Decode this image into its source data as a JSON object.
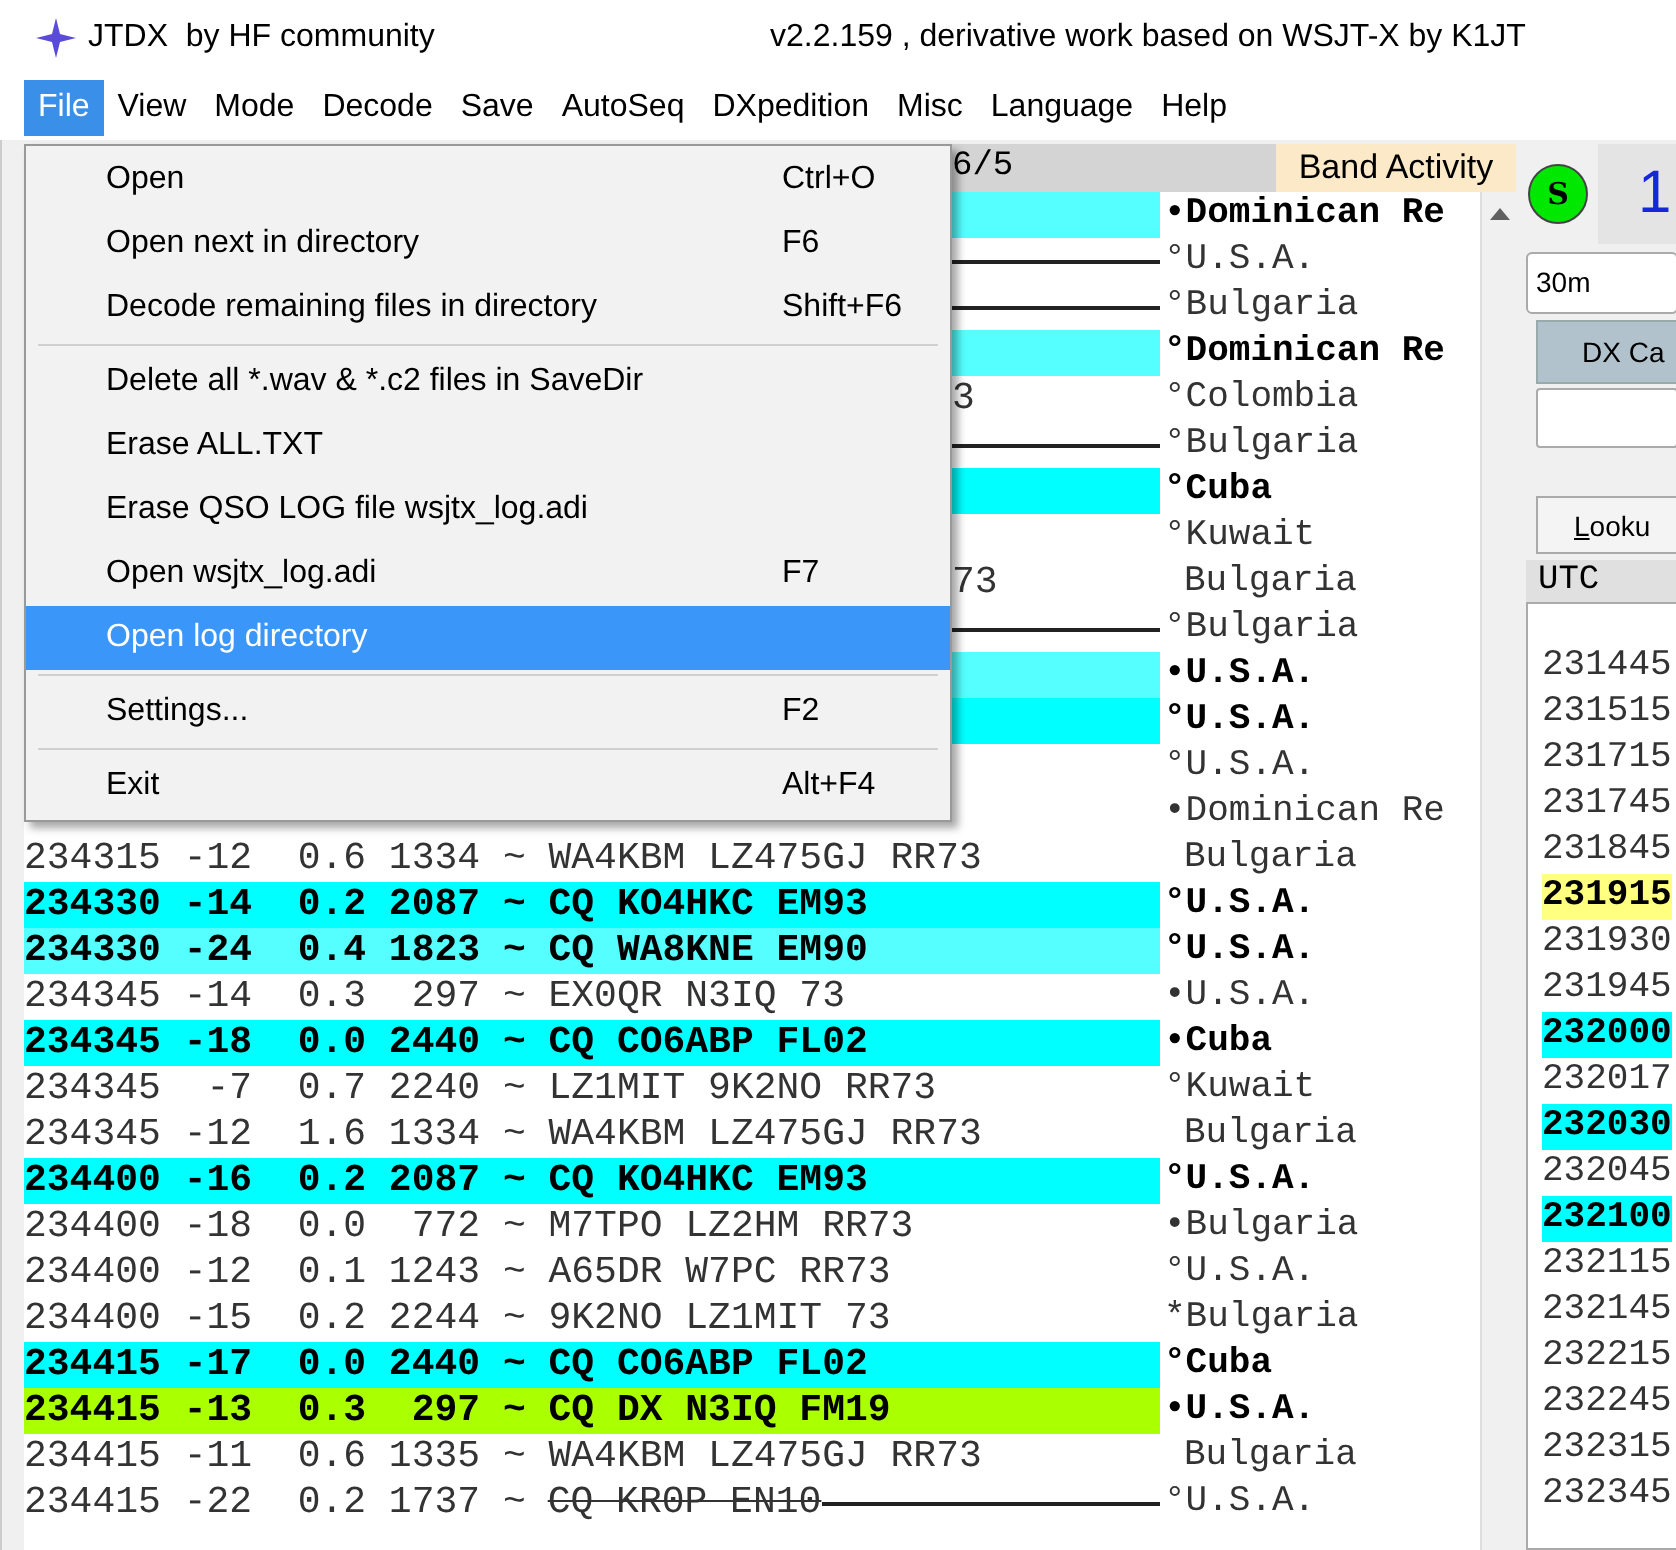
{
  "window": {
    "title": "JTDX  by HF community",
    "subtitle": "v2.2.159 , derivative work based on WSJT-X by K1JT"
  },
  "menu_bar": [
    {
      "label": "File",
      "selected": true
    },
    {
      "label": "View",
      "selected": false
    },
    {
      "label": "Mode",
      "selected": false
    },
    {
      "label": "Decode",
      "selected": false
    },
    {
      "label": "Save",
      "selected": false
    },
    {
      "label": "AutoSeq",
      "selected": false
    },
    {
      "label": "DXpedition",
      "selected": false
    },
    {
      "label": "Misc",
      "selected": false
    },
    {
      "label": "Language",
      "selected": false
    },
    {
      "label": "Help",
      "selected": false
    }
  ],
  "file_menu": [
    {
      "kind": "item",
      "label": "Open",
      "shortcut": "Ctrl+O",
      "selected": false
    },
    {
      "kind": "item",
      "label": "Open next in directory",
      "shortcut": "F6",
      "selected": false
    },
    {
      "kind": "item",
      "label": "Decode remaining files in directory",
      "shortcut": "Shift+F6",
      "selected": false
    },
    {
      "kind": "separator"
    },
    {
      "kind": "item",
      "label": "Delete all *.wav & *.c2 files in SaveDir",
      "selected": false
    },
    {
      "kind": "item",
      "label": "Erase ALL.TXT",
      "selected": false
    },
    {
      "kind": "item",
      "label": "Erase QSO LOG file wsjtx_log.adi",
      "selected": false
    },
    {
      "kind": "item",
      "label": "Open wsjtx_log.adi",
      "shortcut": "F7",
      "selected": false
    },
    {
      "kind": "item",
      "label": "Open log directory",
      "selected": true
    },
    {
      "kind": "separator"
    },
    {
      "kind": "item",
      "label": "Settings...",
      "shortcut": "F2",
      "selected": false
    },
    {
      "kind": "separator"
    },
    {
      "kind": "item",
      "label": "Exit",
      "shortcut": "Alt+F4",
      "selected": false
    }
  ],
  "band_activity": {
    "header_fragment": "6/5",
    "title": "Band Activity",
    "rows": [
      {
        "kind": "hidden",
        "color": "#55ffff",
        "mark": "•",
        "country": "Dominican Re",
        "struck": false
      },
      {
        "kind": "hidden",
        "mark": "°",
        "country": "U.S.A.",
        "struck": true
      },
      {
        "kind": "hidden",
        "mark": "°",
        "country": "Bulgaria",
        "struck": true
      },
      {
        "kind": "hidden",
        "color": "#55ffff",
        "mark": "°",
        "country": "Dominican Re",
        "struck": false
      },
      {
        "kind": "hidden",
        "text": "3",
        "mark": "°",
        "country": "Colombia",
        "struck": false
      },
      {
        "kind": "hidden",
        "mark": "°",
        "country": "Bulgaria",
        "struck": true
      },
      {
        "kind": "hidden",
        "color": "#00ffff",
        "mark": "°",
        "country": "Cuba",
        "struck": false
      },
      {
        "kind": "hidden",
        "mark": "°",
        "country": "Kuwait",
        "struck": false
      },
      {
        "kind": "hidden",
        "text": "73",
        "country": "Bulgaria",
        "struck": false
      },
      {
        "kind": "hidden",
        "mark": "°",
        "country": "Bulgaria",
        "struck": true
      },
      {
        "kind": "hidden",
        "color": "#55ffff",
        "mark": "•",
        "country": "U.S.A.",
        "struck": false
      },
      {
        "kind": "hidden",
        "color": "#00ffff",
        "mark": "°",
        "country": "U.S.A.",
        "struck": false
      },
      {
        "kind": "hidden",
        "mark": "°",
        "country": "U.S.A.",
        "struck": false
      },
      {
        "kind": "hidden",
        "mark": "•",
        "country": "Dominican Re",
        "struck": false
      },
      {
        "kind": "full",
        "text": "234315 -12  0.6 1334 ~ WA4KBM LZ475GJ RR73",
        "country": "Bulgaria",
        "struck": false
      },
      {
        "kind": "full",
        "color": "#00ffff",
        "text": "234330 -14  0.2 2087 ~ CQ KO4HKC EM93",
        "mark": "°",
        "country": "U.S.A.",
        "struck": false
      },
      {
        "kind": "full",
        "color": "#55ffff",
        "text": "234330 -24  0.4 1823 ~ CQ WA8KNE EM90",
        "mark": "°",
        "country": "U.S.A.",
        "struck": false
      },
      {
        "kind": "full",
        "text": "234345 -14  0.3  297 ~ EX0QR N3IQ 73",
        "mark": "•",
        "country": "U.S.A.",
        "struck": false
      },
      {
        "kind": "full",
        "color": "#00ffff",
        "text": "234345 -18  0.0 2440 ~ CQ CO6ABP FL02",
        "mark": "•",
        "country": "Cuba",
        "struck": false
      },
      {
        "kind": "full",
        "text": "234345  -7  0.7 2240 ~ LZ1MIT 9K2NO RR73",
        "mark": "°",
        "country": "Kuwait",
        "struck": false
      },
      {
        "kind": "full",
        "text": "234345 -12  1.6 1334 ~ WA4KBM LZ475GJ RR73",
        "country": "Bulgaria",
        "struck": false
      },
      {
        "kind": "full",
        "color": "#00ffff",
        "text": "234400 -16  0.2 2087 ~ CQ KO4HKC EM93",
        "mark": "°",
        "country": "U.S.A.",
        "struck": false
      },
      {
        "kind": "full",
        "text": "234400 -18  0.0  772 ~ M7TPO LZ2HM RR73",
        "mark": "•",
        "country": "Bulgaria",
        "struck": false
      },
      {
        "kind": "full",
        "text": "234400 -12  0.1 1243 ~ A65DR W7PC RR73",
        "mark": "°",
        "country": "U.S.A.",
        "struck": false
      },
      {
        "kind": "full",
        "text": "234400 -15  0.2 2244 ~ 9K2NO LZ1MIT 73",
        "mark": "*",
        "country": "Bulgaria",
        "struck": false
      },
      {
        "kind": "full",
        "color": "#00ffff",
        "text": "234415 -17  0.0 2440 ~ CQ CO6ABP FL02",
        "mark": "°",
        "country": "Cuba",
        "struck": false
      },
      {
        "kind": "full",
        "color": "#aaff00",
        "text": "234415 -13  0.3  297 ~ CQ DX N3IQ FM19",
        "mark": "•",
        "country": "U.S.A.",
        "struck": false
      },
      {
        "kind": "full",
        "text": "234415 -11  0.6 1335 ~ WA4KBM LZ475GJ RR73",
        "country": "Bulgaria",
        "struck": false
      },
      {
        "kind": "full",
        "text": "234415 -22  0.2 1737 ~",
        "struck_text": "CQ KR0P EN10",
        "mark": "°",
        "country": "U.S.A.",
        "struck": true
      }
    ]
  },
  "side_panel": {
    "status_badge": "S",
    "big_digit": "1",
    "band": "30m",
    "dx_call_button": "DX Ca",
    "lookup_button": "Looku",
    "log_header": "UTC",
    "log_rows": [
      {
        "time": "231445"
      },
      {
        "time": "231515"
      },
      {
        "time": "231715"
      },
      {
        "time": "231745"
      },
      {
        "time": "231845"
      },
      {
        "time": "231915",
        "color": "#ffff80"
      },
      {
        "time": "231930"
      },
      {
        "time": "231945"
      },
      {
        "time": "232000",
        "color": "#00ffff"
      },
      {
        "time": "232017"
      },
      {
        "time": "232030",
        "color": "#00ffff"
      },
      {
        "time": "232045"
      },
      {
        "time": "232100",
        "color": "#00ffff"
      },
      {
        "time": "232115"
      },
      {
        "time": "232145"
      },
      {
        "time": "232215"
      },
      {
        "time": "232245"
      },
      {
        "time": "232315"
      },
      {
        "time": "232345"
      }
    ]
  }
}
